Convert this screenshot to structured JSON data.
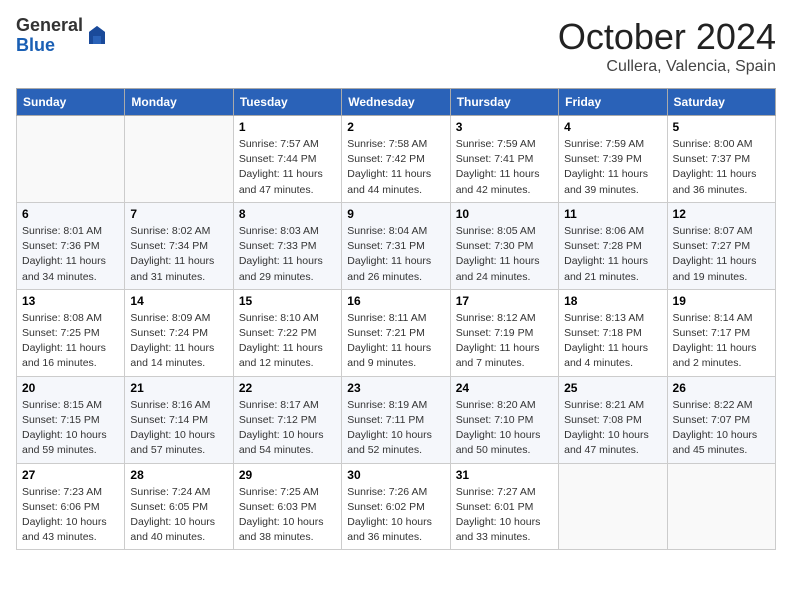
{
  "header": {
    "logo_general": "General",
    "logo_blue": "Blue",
    "title": "October 2024",
    "location": "Cullera, Valencia, Spain"
  },
  "weekdays": [
    "Sunday",
    "Monday",
    "Tuesday",
    "Wednesday",
    "Thursday",
    "Friday",
    "Saturday"
  ],
  "weeks": [
    [
      {
        "day": "",
        "details": ""
      },
      {
        "day": "",
        "details": ""
      },
      {
        "day": "1",
        "details": "Sunrise: 7:57 AM\nSunset: 7:44 PM\nDaylight: 11 hours and 47 minutes."
      },
      {
        "day": "2",
        "details": "Sunrise: 7:58 AM\nSunset: 7:42 PM\nDaylight: 11 hours and 44 minutes."
      },
      {
        "day": "3",
        "details": "Sunrise: 7:59 AM\nSunset: 7:41 PM\nDaylight: 11 hours and 42 minutes."
      },
      {
        "day": "4",
        "details": "Sunrise: 7:59 AM\nSunset: 7:39 PM\nDaylight: 11 hours and 39 minutes."
      },
      {
        "day": "5",
        "details": "Sunrise: 8:00 AM\nSunset: 7:37 PM\nDaylight: 11 hours and 36 minutes."
      }
    ],
    [
      {
        "day": "6",
        "details": "Sunrise: 8:01 AM\nSunset: 7:36 PM\nDaylight: 11 hours and 34 minutes."
      },
      {
        "day": "7",
        "details": "Sunrise: 8:02 AM\nSunset: 7:34 PM\nDaylight: 11 hours and 31 minutes."
      },
      {
        "day": "8",
        "details": "Sunrise: 8:03 AM\nSunset: 7:33 PM\nDaylight: 11 hours and 29 minutes."
      },
      {
        "day": "9",
        "details": "Sunrise: 8:04 AM\nSunset: 7:31 PM\nDaylight: 11 hours and 26 minutes."
      },
      {
        "day": "10",
        "details": "Sunrise: 8:05 AM\nSunset: 7:30 PM\nDaylight: 11 hours and 24 minutes."
      },
      {
        "day": "11",
        "details": "Sunrise: 8:06 AM\nSunset: 7:28 PM\nDaylight: 11 hours and 21 minutes."
      },
      {
        "day": "12",
        "details": "Sunrise: 8:07 AM\nSunset: 7:27 PM\nDaylight: 11 hours and 19 minutes."
      }
    ],
    [
      {
        "day": "13",
        "details": "Sunrise: 8:08 AM\nSunset: 7:25 PM\nDaylight: 11 hours and 16 minutes."
      },
      {
        "day": "14",
        "details": "Sunrise: 8:09 AM\nSunset: 7:24 PM\nDaylight: 11 hours and 14 minutes."
      },
      {
        "day": "15",
        "details": "Sunrise: 8:10 AM\nSunset: 7:22 PM\nDaylight: 11 hours and 12 minutes."
      },
      {
        "day": "16",
        "details": "Sunrise: 8:11 AM\nSunset: 7:21 PM\nDaylight: 11 hours and 9 minutes."
      },
      {
        "day": "17",
        "details": "Sunrise: 8:12 AM\nSunset: 7:19 PM\nDaylight: 11 hours and 7 minutes."
      },
      {
        "day": "18",
        "details": "Sunrise: 8:13 AM\nSunset: 7:18 PM\nDaylight: 11 hours and 4 minutes."
      },
      {
        "day": "19",
        "details": "Sunrise: 8:14 AM\nSunset: 7:17 PM\nDaylight: 11 hours and 2 minutes."
      }
    ],
    [
      {
        "day": "20",
        "details": "Sunrise: 8:15 AM\nSunset: 7:15 PM\nDaylight: 10 hours and 59 minutes."
      },
      {
        "day": "21",
        "details": "Sunrise: 8:16 AM\nSunset: 7:14 PM\nDaylight: 10 hours and 57 minutes."
      },
      {
        "day": "22",
        "details": "Sunrise: 8:17 AM\nSunset: 7:12 PM\nDaylight: 10 hours and 54 minutes."
      },
      {
        "day": "23",
        "details": "Sunrise: 8:19 AM\nSunset: 7:11 PM\nDaylight: 10 hours and 52 minutes."
      },
      {
        "day": "24",
        "details": "Sunrise: 8:20 AM\nSunset: 7:10 PM\nDaylight: 10 hours and 50 minutes."
      },
      {
        "day": "25",
        "details": "Sunrise: 8:21 AM\nSunset: 7:08 PM\nDaylight: 10 hours and 47 minutes."
      },
      {
        "day": "26",
        "details": "Sunrise: 8:22 AM\nSunset: 7:07 PM\nDaylight: 10 hours and 45 minutes."
      }
    ],
    [
      {
        "day": "27",
        "details": "Sunrise: 7:23 AM\nSunset: 6:06 PM\nDaylight: 10 hours and 43 minutes."
      },
      {
        "day": "28",
        "details": "Sunrise: 7:24 AM\nSunset: 6:05 PM\nDaylight: 10 hours and 40 minutes."
      },
      {
        "day": "29",
        "details": "Sunrise: 7:25 AM\nSunset: 6:03 PM\nDaylight: 10 hours and 38 minutes."
      },
      {
        "day": "30",
        "details": "Sunrise: 7:26 AM\nSunset: 6:02 PM\nDaylight: 10 hours and 36 minutes."
      },
      {
        "day": "31",
        "details": "Sunrise: 7:27 AM\nSunset: 6:01 PM\nDaylight: 10 hours and 33 minutes."
      },
      {
        "day": "",
        "details": ""
      },
      {
        "day": "",
        "details": ""
      }
    ]
  ]
}
